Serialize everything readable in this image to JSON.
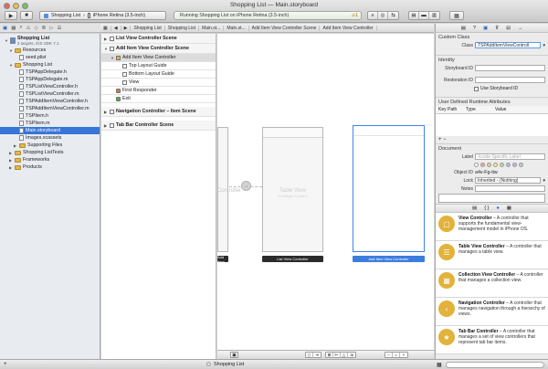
{
  "window": {
    "title": "Shopping List — Main.storyboard"
  },
  "toolbar": {
    "scheme_target": "Shopping List",
    "scheme_device": "iPhone Retina (3.5-inch)",
    "status_text": "Running Shopping List on iPhone Retina (3.5-inch)",
    "warning_count": "1"
  },
  "jumpbar": [
    "Shopping List",
    "Shopping List",
    "Main.st...",
    "Main.st...",
    "Add Item View Controller Scene",
    "Add Item View Controller"
  ],
  "navigator": {
    "items": [
      {
        "label": "Shopping List",
        "sub": "2 targets, iOS SDK 7.1",
        "indent": 1,
        "kind": "project"
      },
      {
        "label": "Resources",
        "indent": 2,
        "kind": "folder"
      },
      {
        "label": "seed.plist",
        "indent": 3,
        "kind": "file"
      },
      {
        "label": "Shopping List",
        "indent": 2,
        "kind": "folder"
      },
      {
        "label": "TSPAppDelegate.h",
        "indent": 3,
        "kind": "file"
      },
      {
        "label": "TSPAppDelegate.m",
        "indent": 3,
        "kind": "file"
      },
      {
        "label": "TSPListViewController.h",
        "indent": 3,
        "kind": "file"
      },
      {
        "label": "TSPListViewController.m",
        "indent": 3,
        "kind": "file"
      },
      {
        "label": "TSPAddItemViewController.h",
        "indent": 3,
        "kind": "file"
      },
      {
        "label": "TSPAddItemViewController.m",
        "indent": 3,
        "kind": "file"
      },
      {
        "label": "TSPItem.h",
        "indent": 3,
        "kind": "file"
      },
      {
        "label": "TSPItem.m",
        "indent": 3,
        "kind": "file"
      },
      {
        "label": "Main.storyboard",
        "indent": 3,
        "kind": "file",
        "selected": true
      },
      {
        "label": "Images.xcassets",
        "indent": 3,
        "kind": "file"
      },
      {
        "label": "Supporting Files",
        "indent": 3,
        "kind": "folder"
      },
      {
        "label": "Shopping ListTests",
        "indent": 2,
        "kind": "folder"
      },
      {
        "label": "Frameworks",
        "indent": 2,
        "kind": "folder"
      },
      {
        "label": "Products",
        "indent": 2,
        "kind": "folder"
      }
    ]
  },
  "outline": {
    "items": [
      {
        "label": "List View Controller Scene",
        "indent": 0,
        "scene": true
      },
      {
        "label": "Add Item View Controller Scene",
        "indent": 0,
        "scene": true
      },
      {
        "label": "Add Item View Controller",
        "indent": 1,
        "highlight": true
      },
      {
        "label": "Top Layout Guide",
        "indent": 2
      },
      {
        "label": "Bottom Layout Guide",
        "indent": 2
      },
      {
        "label": "View",
        "indent": 2
      },
      {
        "label": "First Responder",
        "indent": 1
      },
      {
        "label": "Exit",
        "indent": 1
      },
      {
        "label": "Navigation Controller – Item Scene",
        "indent": 0,
        "scene": true
      },
      {
        "label": "Tab Bar Controller Scene",
        "indent": 0,
        "scene": true
      }
    ]
  },
  "canvas": {
    "partial_scene_text": "Controller",
    "partial_scene_label": "Add Item",
    "table_view_title": "Table View",
    "table_view_sub": "Prototype Content",
    "list_scene_label": "List View Controller",
    "add_scene_label": "Add Item View Controller"
  },
  "inspector": {
    "custom_class_header": "Custom Class",
    "class_label": "Class",
    "class_value": "TSPAddItemViewControll",
    "identity_header": "Identity",
    "storyboard_id_label": "Storyboard ID",
    "restoration_id_label": "Restoration ID",
    "use_storyboard_id": "Use Storyboard ID",
    "runtime_header": "User Defined Runtime Attributes",
    "col_keypath": "Key Path",
    "col_type": "Type",
    "col_value": "Value",
    "add_remove": "+ −",
    "document_header": "Document",
    "label_label": "Label",
    "label_placeholder": "Xcode Specific Label",
    "object_id_label": "Object ID",
    "object_id_value": "a4v-Fg-tiw",
    "lock_label": "Lock",
    "lock_value": "Inherited - (Nothing)",
    "notes_label": "Notes",
    "label_colors": [
      "#ffffff",
      "#f2a7a7",
      "#f6c98c",
      "#f4ec8c",
      "#b7e39b",
      "#9fc7f0",
      "#d1b1ea",
      "#c8c8c8"
    ]
  },
  "library": [
    {
      "title": "View Controller",
      "desc": "A controller that supports the fundamental view-management model in iPhone OS.",
      "color": "#e2b23a",
      "glyph": "▢"
    },
    {
      "title": "Table View Controller",
      "desc": "A controller that manages a table view.",
      "color": "#e2b23a",
      "glyph": "☰"
    },
    {
      "title": "Collection View Controller",
      "desc": "A controller that manages a collection view.",
      "color": "#e2b23a",
      "glyph": "▦"
    },
    {
      "title": "Navigation Controller",
      "desc": "A controller that manages navigation through a hierarchy of views.",
      "color": "#e2b23a",
      "glyph": "‹"
    },
    {
      "title": "Tab Bar Controller",
      "desc": "A controller that manages a set of view controllers that represent tab bar items.",
      "color": "#e2b23a",
      "glyph": "★"
    }
  ],
  "bottom": {
    "target_label": "Shopping List"
  }
}
